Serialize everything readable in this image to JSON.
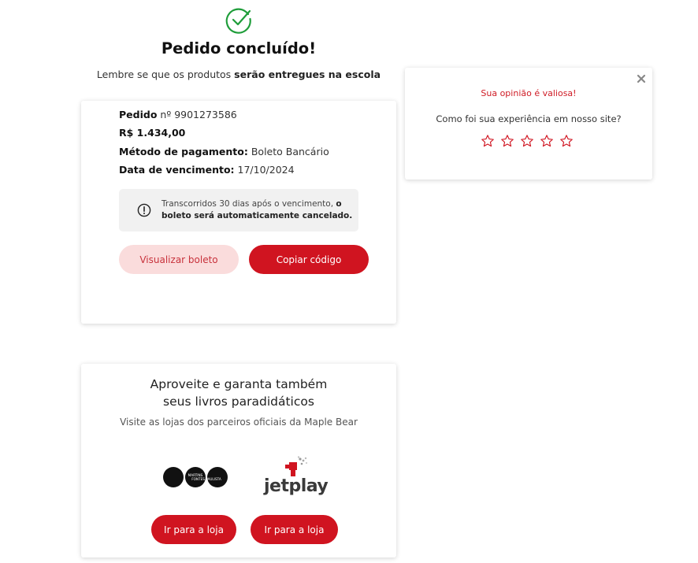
{
  "header": {
    "title": "Pedido concluído!",
    "subtitle_prefix": "Lembre se que os produtos ",
    "subtitle_bold": "serão entregues na escola"
  },
  "order": {
    "order_label": "Pedido",
    "order_number": "nº 9901273586",
    "total": "R$ 1.434,00",
    "payment_label": "Método de pagamento:",
    "payment_value": "Boleto Bancário",
    "due_label": "Data de vencimento:",
    "due_value": "17/10/2024",
    "notice_prefix": "Transcorridos 30 dias após o vencimento, ",
    "notice_bold": "o boleto será automaticamente cancelado.",
    "view_button": "Visualizar boleto",
    "copy_button": "Copiar código"
  },
  "partners": {
    "title_line1": "Aproveite e garanta também",
    "title_line2": "seus livros paradidáticos",
    "subtitle": "Visite as lojas dos parceiros oficiais da Maple Bear",
    "stores": [
      {
        "logo_text": "MARTINS FONTES PAULISTA",
        "button": "Ir para a loja"
      },
      {
        "logo_text": "jetplay",
        "button": "Ir para a loja"
      }
    ]
  },
  "feedback": {
    "title": "Sua opinião é valiosa!",
    "question": "Como foi sua experiência em nosso site?",
    "rating": 0,
    "max_rating": 5
  },
  "colors": {
    "primary_red": "#d01420",
    "light_red": "#fadcdc",
    "success_green": "#1f9d3a"
  },
  "icons": [
    "check-circle-icon",
    "info-icon",
    "close-icon",
    "star-outline-icon"
  ]
}
